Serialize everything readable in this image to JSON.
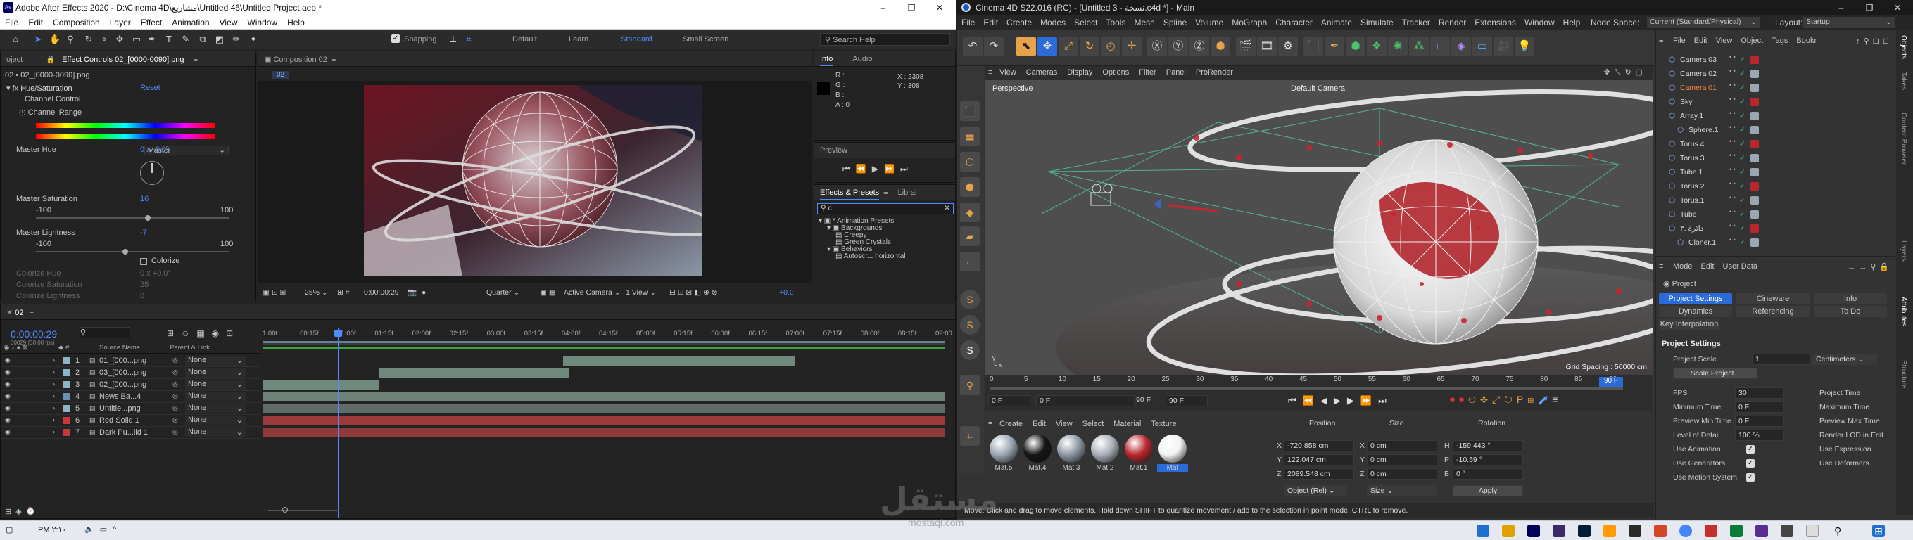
{
  "ae": {
    "title": "Adobe After Effects 2020 - D:\\Cinema 4D\\مشاريع\\Untitled 46\\Untitled Project.aep *",
    "logo": "Ae",
    "menu": [
      "File",
      "Edit",
      "Composition",
      "Layer",
      "Effect",
      "Animation",
      "View",
      "Window",
      "Help"
    ],
    "workspace": {
      "default": "Default",
      "learn": "Learn",
      "standard": "Standard",
      "small": "Small Screen"
    },
    "snapping": "Snapping",
    "search_help": "Search Help",
    "effect_controls": {
      "project_tab": "oject",
      "tab": "Effect Controls 02_[0000-0090].png",
      "layer": "02 • 02_[0000-0090].png",
      "effect": "Hue/Saturation",
      "reset": "Reset",
      "channel_control_label": "Channel Control",
      "channel_control_value": "Master",
      "channel_range": "Channel Range",
      "master_hue": "Master Hue",
      "master_hue_value": "0 x -3.0°",
      "master_saturation": "Master Saturation",
      "master_saturation_value": "16",
      "sat_min": "-100",
      "sat_max": "100",
      "master_lightness": "Master Lightness",
      "master_lightness_value": "-7",
      "light_min": "-100",
      "light_max": "100",
      "colorize": "Colorize",
      "colorize_hue": "Colorize Hue",
      "colorize_hue_value": "0 x +0.0°",
      "colorize_saturation": "Colorize Saturation",
      "colorize_saturation_value": "25",
      "colorize_lightness": "Colorize Lightness",
      "colorize_lightness_value": "0"
    },
    "composition": {
      "tab": "Composition 02",
      "crumb": "02",
      "zoom": "25%",
      "timecode": "0:00:00:29",
      "quality": "Quarter",
      "camera": "Active Camera",
      "views": "1 View",
      "exposure": "+0.0"
    },
    "info": {
      "tab": "Info",
      "audio_tab": "Audio",
      "r": "R :",
      "g": "G :",
      "b": "B :",
      "a": "A :  0",
      "x": "X : 2308",
      "y": "Y : 308"
    },
    "preview": {
      "tab": "Preview"
    },
    "effects_presets": {
      "tab": "Effects & Presets",
      "libraries_tab": "Librai",
      "search_value": "c",
      "tree": [
        "* Animation Presets",
        "Backgrounds",
        "Creepy",
        "Green Crystals",
        "Behaviors",
        "Autoscr... horizontal"
      ]
    },
    "timeline": {
      "comp_tab": "02",
      "timecode": "0:00:00:29",
      "fps_note": "00029 (30.00 fps)",
      "headers": {
        "source": "Source Name",
        "parent": "Parent & Link"
      },
      "ruler": [
        "1:00f",
        "00:15f",
        "01:00f",
        "01:15f",
        "02:00f",
        "02:15f",
        "03:00f",
        "03:15f",
        "04:00f",
        "04:15f",
        "05:00f",
        "05:15f",
        "06:00f",
        "06:15f",
        "07:00f",
        "07:15f",
        "08:00f",
        "08:15f",
        "09:00"
      ],
      "layers": [
        {
          "num": "1",
          "name": "01_[000...png",
          "parent": "None",
          "color": "#8fb4c9",
          "start": 0.44,
          "end": 0.78,
          "bar": "#6f8a7d"
        },
        {
          "num": "2",
          "name": "03_[000...png",
          "parent": "None",
          "color": "#8fb4c9",
          "start": 0.17,
          "end": 0.45,
          "bar": "#6f8a7d"
        },
        {
          "num": "3",
          "name": "02_[000...png",
          "parent": "None",
          "color": "#8fb4c9",
          "start": 0.0,
          "end": 0.17,
          "bar": "#6f8a7d"
        },
        {
          "num": "4",
          "name": "News Ba...4",
          "parent": "None",
          "color": "#6a8fb0",
          "start": 0.0,
          "end": 1.0,
          "bar": "#6d8279"
        },
        {
          "num": "5",
          "name": "Untitle...png",
          "parent": "None",
          "color": "#8fb4c9",
          "start": 0.0,
          "end": 1.0,
          "bar": "#5f6c6a"
        },
        {
          "num": "6",
          "name": "Red Solid 1",
          "parent": "None",
          "color": "#c43a3a",
          "start": 0.0,
          "end": 1.0,
          "bar": "#9c3b3b"
        },
        {
          "num": "7",
          "name": "Dark Pu...lid 1",
          "parent": "None",
          "color": "#c43a3a",
          "start": 0.0,
          "end": 1.0,
          "bar": "#8f3a3a"
        }
      ],
      "playhead": 0.11
    }
  },
  "c4d": {
    "title": "Cinema 4D S22.016 (RC) - [Untitled 3 - نسخة.c4d *] - Main",
    "menu": [
      "File",
      "Edit",
      "Create",
      "Modes",
      "Select",
      "Tools",
      "Mesh",
      "Spline",
      "Volume",
      "MoGraph",
      "Character",
      "Animate",
      "Simulate",
      "Tracker",
      "Render",
      "Extensions",
      "Window",
      "Help"
    ],
    "node_space_label": "Node Space:",
    "node_space_value": "Current (Standard/Physical)",
    "layout_label": "Layout:",
    "layout_value": "Startup",
    "viewport_menu": [
      "View",
      "Cameras",
      "Display",
      "Options",
      "Filter",
      "Panel",
      "ProRender"
    ],
    "viewport_label": "Perspective",
    "camera_label": "Default Camera",
    "grid_spacing": "Grid Spacing : 50000 cm",
    "timeline_ticks": [
      "0",
      "5",
      "10",
      "15",
      "20",
      "25",
      "30",
      "35",
      "40",
      "45",
      "50",
      "55",
      "60",
      "65",
      "70",
      "75",
      "80",
      "85",
      "90"
    ],
    "frame_current": "90 F",
    "frame_start": "0 F",
    "frame_start2": "0 F",
    "frame_end": "90 F",
    "frame_end2": "90 F",
    "material_menu": [
      "Create",
      "Edit",
      "View",
      "Select",
      "Material",
      "Texture"
    ],
    "materials": [
      {
        "name": "Mat.5",
        "color": "#9aa7b3"
      },
      {
        "name": "Mat.4",
        "color": "#141414"
      },
      {
        "name": "Mat.3",
        "color": "#8d98a4"
      },
      {
        "name": "Mat.2",
        "color": "#a9b0b8"
      },
      {
        "name": "Mat.1",
        "color": "#b8272d"
      },
      {
        "name": "Mat",
        "color": "#f2f2f2"
      }
    ],
    "coords": {
      "headers": [
        "Position",
        "Size",
        "Rotation"
      ],
      "x": "-720.858 cm",
      "y": "122.047 cm",
      "z": "2089.548 cm",
      "sx": "0 cm",
      "sy": "0 cm",
      "sz": "0 cm",
      "h": "-159.443 °",
      "p": "-10.59 °",
      "b": "0 °",
      "mode": "Object (Rel)",
      "size_mode": "Size",
      "apply": "Apply"
    },
    "status": "Move: Click and drag to move elements. Hold down SHIFT to quantize movement / add to the selection in point mode, CTRL to remove.",
    "objects_menu": [
      "File",
      "Edit",
      "View",
      "Object",
      "Tags",
      "Bookr"
    ],
    "objects": [
      {
        "name": "Camera 03",
        "indent": 0,
        "color": "#ddd"
      },
      {
        "name": "Camera 02",
        "indent": 0,
        "color": "#ddd"
      },
      {
        "name": "Camera 01",
        "indent": 0,
        "color": "#ff8a3a"
      },
      {
        "name": "Sky",
        "indent": 0,
        "color": "#ddd"
      },
      {
        "name": "Array.1",
        "indent": 0,
        "color": "#ddd"
      },
      {
        "name": "Sphere.1",
        "indent": 1,
        "color": "#ddd"
      },
      {
        "name": "Torus.4",
        "indent": 0,
        "color": "#ddd"
      },
      {
        "name": "Torus.3",
        "indent": 0,
        "color": "#ddd"
      },
      {
        "name": "Tube.1",
        "indent": 0,
        "color": "#ddd"
      },
      {
        "name": "Torus.2",
        "indent": 0,
        "color": "#ddd"
      },
      {
        "name": "Torus.1",
        "indent": 0,
        "color": "#ddd"
      },
      {
        "name": "Tube",
        "indent": 0,
        "color": "#ddd"
      },
      {
        "name": "دائرة .٣",
        "indent": 0,
        "color": "#ddd"
      },
      {
        "name": "Cloner.1",
        "indent": 1,
        "color": "#ddd"
      }
    ],
    "attr_menu": [
      "Mode",
      "Edit",
      "User Data"
    ],
    "attr_title": "Project",
    "attr_tabs": [
      "Project Settings",
      "Cineware",
      "Info",
      "Dynamics",
      "Referencing",
      "To Do",
      "Key Interpolation"
    ],
    "attr_section": "Project Settings",
    "project_scale_label": "Project Scale",
    "project_scale_value": "1",
    "project_scale_unit": "Centimeters",
    "scale_project_btn": "Scale Project...",
    "settings": [
      {
        "label": "FPS",
        "value": "30",
        "right": "Project Time"
      },
      {
        "label": "Minimum Time",
        "value": "0 F",
        "right": "Maximum Time"
      },
      {
        "label": "Preview Min Time",
        "value": "0 F",
        "right": "Preview Max Time"
      },
      {
        "label": "Level of Detail",
        "value": "100 %",
        "right": "Render LOD in Edit"
      }
    ],
    "checks": [
      {
        "label": "Use Animation",
        "right": "Use Expression"
      },
      {
        "label": "Use Generators",
        "right": "Use Deformers"
      },
      {
        "label": "Use Motion System",
        "right": ""
      }
    ],
    "side_tabs": [
      "Objects",
      "Takes",
      "Content Browser",
      "Layers",
      "Attributes",
      "Structure"
    ]
  },
  "taskbar": {
    "clock": "PM ٢:١٠",
    "watermark": "مستقل",
    "watermark_sub": "mostaql.com"
  }
}
